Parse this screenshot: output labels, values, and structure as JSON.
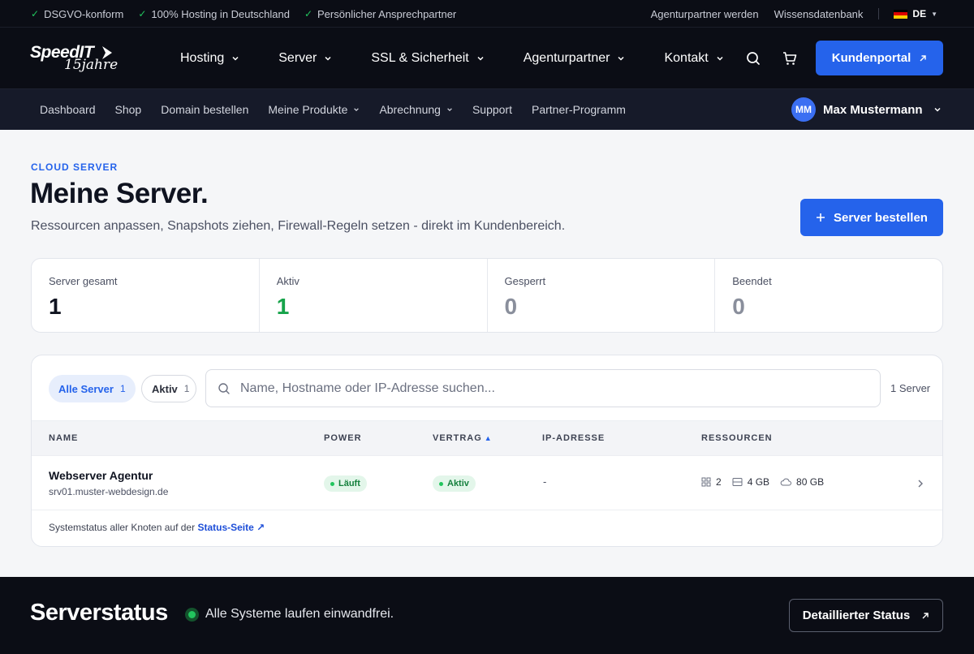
{
  "topbar": {
    "badges": [
      "DSGVO-konform",
      "100% Hosting in Deutschland",
      "Persönlicher Ansprechpartner"
    ],
    "links": [
      "Agenturpartner werden",
      "Wissensdatenbank"
    ],
    "language": "DE",
    "flag_colors": [
      "#000000",
      "#dd0000",
      "#ffce00"
    ]
  },
  "header": {
    "logo_brand": "SpeedIT",
    "logo_years": "15jahre",
    "nav": [
      "Hosting",
      "Server",
      "SSL & Sicherheit",
      "Agenturpartner",
      "Kontakt"
    ],
    "portal_button": "Kundenportal",
    "icons": [
      "search-icon",
      "cart-icon"
    ]
  },
  "subnav": {
    "items": [
      {
        "label": "Dashboard"
      },
      {
        "label": "Shop"
      },
      {
        "label": "Domain bestellen"
      },
      {
        "label": "Meine Produkte"
      },
      {
        "label": "Abrechnung"
      },
      {
        "label": "Support"
      },
      {
        "label": "Partner-Programm"
      }
    ],
    "user_initials": "MM",
    "user_name": "Max Mustermann"
  },
  "hero": {
    "eyebrow": "CLOUD SERVER",
    "title": "Meine Server.",
    "subtitle": "Ressourcen anpassen, Snapshots ziehen, Firewall-Regeln setzen - direkt im Kundenbereich.",
    "order_button": "Server bestellen"
  },
  "stats": [
    {
      "label": "Server gesamt",
      "value": "1",
      "color": "#0f1320"
    },
    {
      "label": "Aktiv",
      "value": "1",
      "color": "#16a34a"
    },
    {
      "label": "Gesperrt",
      "value": "0",
      "color": "#8a8f9c"
    },
    {
      "label": "Beendet",
      "value": "0",
      "color": "#8a8f9c"
    }
  ],
  "list": {
    "filters": [
      {
        "label": "Alle Server",
        "count": "1"
      },
      {
        "label": "Aktiv",
        "count": "1"
      }
    ],
    "search_placeholder": "Name, Hostname oder IP-Adresse suchen...",
    "result_count": "1 Server",
    "columns": [
      "NAME",
      "POWER",
      "VERTRAG",
      "IP-ADRESSE",
      "RESSOURCEN"
    ],
    "sort_indicator": "▲",
    "rows": [
      {
        "name": "Webserver Agentur",
        "host": "srv01.muster-webdesign.de",
        "power": "Läuft",
        "contract": "Aktiv",
        "ip": "-",
        "cpu": "2",
        "ram": "4 GB",
        "disk": "80 GB"
      }
    ],
    "footer_text": "Systemstatus aller Knoten auf der",
    "footer_link": "Status-Seite ↗"
  },
  "status": {
    "title": "Serverstatus",
    "text": "Alle Systeme laufen einwandfrei.",
    "button": "Detaillierter Status"
  },
  "colors": {
    "accent": "#2563eb",
    "success": "#22c55e",
    "dark_bg": "#0b0d15"
  }
}
